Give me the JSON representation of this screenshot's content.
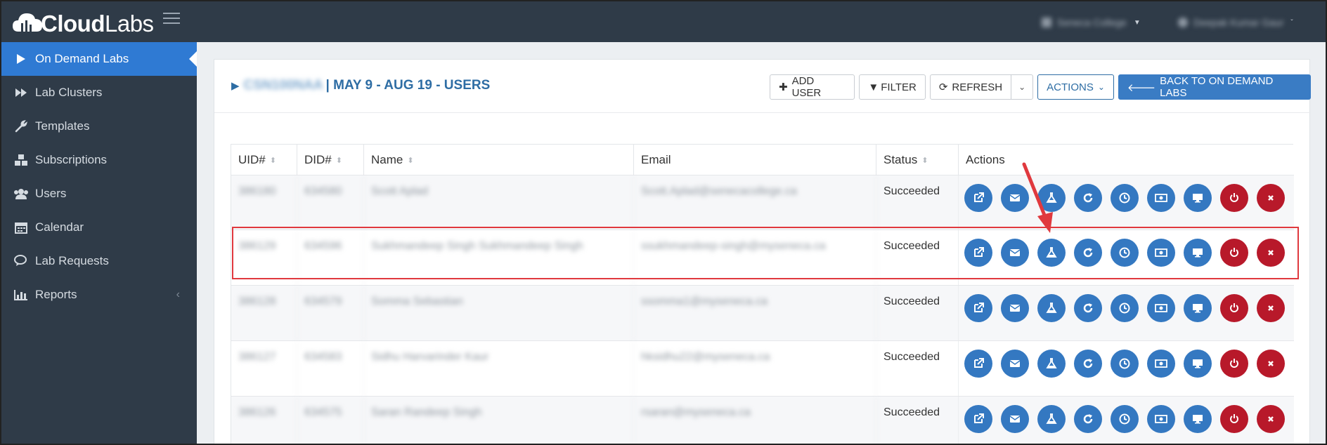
{
  "app": {
    "logo_bold": "Cloud",
    "logo_light": "Labs"
  },
  "topbar": {
    "org_name": "Seneca College",
    "user_name": "Deepak Kumar Gaur"
  },
  "sidebar": {
    "items": [
      {
        "label": "On Demand Labs",
        "icon": "play-icon",
        "active": true
      },
      {
        "label": "Lab Clusters",
        "icon": "fast-forward-icon"
      },
      {
        "label": "Templates",
        "icon": "wrench-icon"
      },
      {
        "label": "Subscriptions",
        "icon": "cubes-icon"
      },
      {
        "label": "Users",
        "icon": "users-icon"
      },
      {
        "label": "Calendar",
        "icon": "calendar-icon"
      },
      {
        "label": "Lab Requests",
        "icon": "comments-icon"
      },
      {
        "label": "Reports",
        "icon": "bar-chart-icon",
        "has_chevron": true
      }
    ]
  },
  "page": {
    "title_blurred": "CSN100NAA",
    "title_suffix": "| MAY 9 - AUG 19 - USERS"
  },
  "toolbar": {
    "add_user": "ADD USER",
    "filter": "FILTER",
    "refresh": "REFRESH",
    "actions": "ACTIONS",
    "back": "BACK TO ON DEMAND LABS"
  },
  "table": {
    "headers": {
      "uid": "UID#",
      "did": "DID#",
      "name": "Name",
      "email": "Email",
      "status": "Status",
      "actions": "Actions"
    },
    "rows": [
      {
        "uid": "386180",
        "did": "634580",
        "name": "Scott Aplad",
        "email": "Scott.Aplad@senecacollege.ca",
        "status": "Succeeded"
      },
      {
        "uid": "386129",
        "did": "634596",
        "name": "Sukhmandeep Singh Sukhmandeep Singh",
        "email": "ssukhmandeep-singh@myseneca.ca",
        "status": "Succeeded"
      },
      {
        "uid": "386128",
        "did": "634579",
        "name": "Somma Sebastian",
        "email": "ssomma1@myseneca.ca",
        "status": "Succeeded"
      },
      {
        "uid": "386127",
        "did": "634583",
        "name": "Sidhu Harvarinder Kaur",
        "email": "hksidhu22@myseneca.ca",
        "status": "Succeeded"
      },
      {
        "uid": "386126",
        "did": "634575",
        "name": "Saran Randeep Singh",
        "email": "rsaran@myseneca.ca",
        "status": "Succeeded"
      }
    ],
    "action_icons": [
      "external-link-icon",
      "envelope-icon",
      "flask-icon",
      "redo-icon",
      "clock-icon",
      "money-icon",
      "desktop-icon",
      "power-icon",
      "delete-icon"
    ]
  },
  "colors": {
    "primary": "#3478c1",
    "danger": "#b8192a",
    "sidebar": "#2f3b48",
    "highlight": "#e0393e"
  }
}
